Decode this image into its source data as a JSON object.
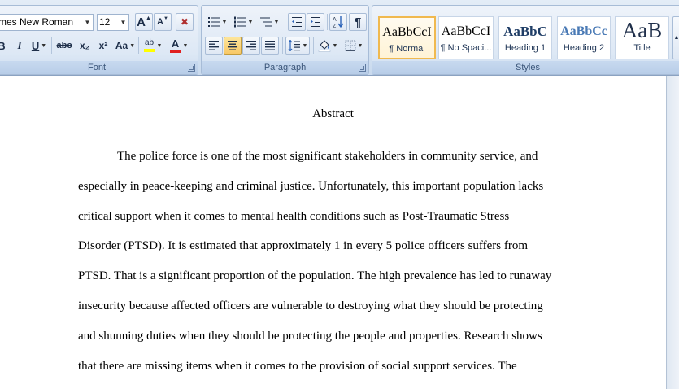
{
  "ribbon": {
    "font": {
      "label": "Font",
      "family": "mes New Roman",
      "size": "12",
      "grow_label": "A",
      "shrink_label": "A",
      "clear_label": "✖",
      "bold": "B",
      "italic": "I",
      "underline": "U",
      "strike": "abc",
      "subscript": "x₂",
      "superscript": "x²",
      "change_case": "Aa",
      "highlight": "ab",
      "font_color": "A",
      "highlight_color": "#ffff00",
      "font_color_value": "#e02020"
    },
    "paragraph": {
      "label": "Paragraph",
      "show_marks": "¶"
    },
    "styles": {
      "label": "Styles",
      "items": [
        {
          "sample": "AaBbCcI",
          "name": "¶ Normal"
        },
        {
          "sample": "AaBbCcI",
          "name": "¶ No Spaci..."
        },
        {
          "sample": "AaBbC",
          "name": "Heading 1"
        },
        {
          "sample": "AaBbCc",
          "name": "Heading 2"
        },
        {
          "sample": "AaB",
          "name": "Title"
        }
      ]
    }
  },
  "document": {
    "title": "Abstract",
    "lines": [
      "The police force is one of the most significant stakeholders in community service, and",
      "especially in peace-keeping and criminal justice. Unfortunately, this important population lacks",
      "critical support when it comes to mental health conditions such as Post-Traumatic Stress",
      "Disorder (PTSD). It is estimated that approximately 1 in every 5 police officers suffers from",
      "PTSD. That is a significant proportion of the population. The high prevalence has led to runaway",
      "insecurity because affected officers are vulnerable to destroying what they should be protecting",
      "and shunning duties when they should be protecting the people and properties. Research shows",
      "that there are missing items when it comes to the provision of social support services. The"
    ]
  }
}
